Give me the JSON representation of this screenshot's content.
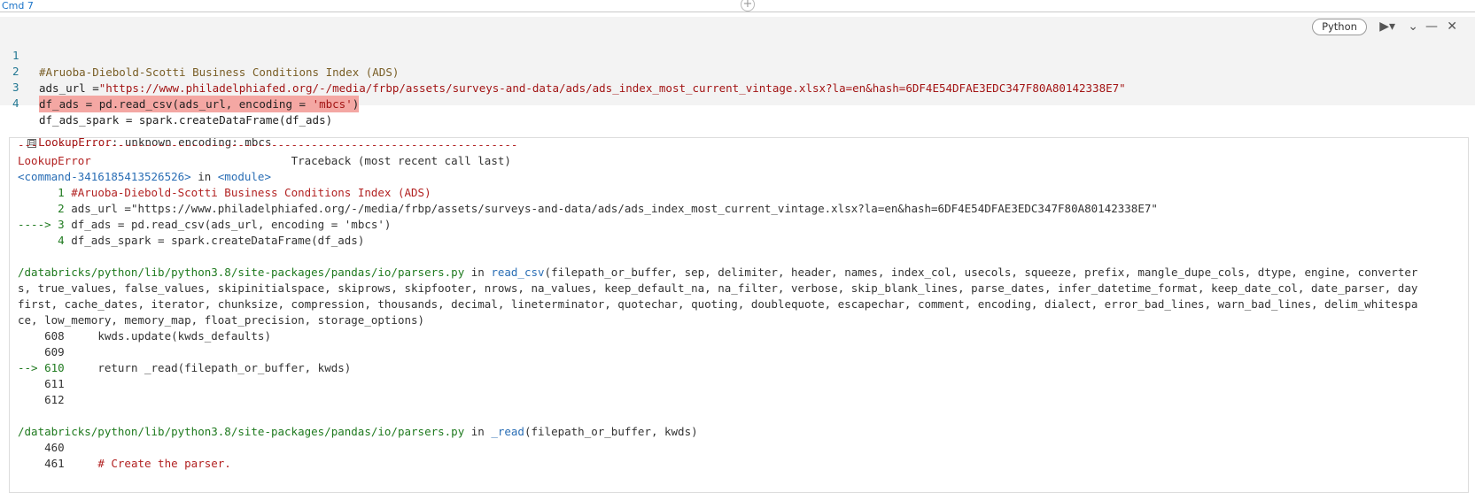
{
  "cmd": {
    "label": "Cmd 7",
    "add_icon": "+"
  },
  "toolbar": {
    "language": "Python",
    "run_icon": "▶▾",
    "collapse_icon": "⌄",
    "minimize_icon": "—",
    "close_icon": "✕"
  },
  "code_lines": [
    {
      "num": "1",
      "text": "#Aruoba-Diebold-Scotti Business Conditions Index (ADS)"
    },
    {
      "num": "2",
      "prefix": "ads_url =",
      "string": "\"https://www.philadelphiafed.org/-/media/frbp/assets/surveys-and-data/ads/ads_index_most_current_vintage.xlsx?la=en&hash=6DF4E54DFAE3EDC347F80A80142338E7\""
    },
    {
      "num": "3",
      "prefix": "df_ads = pd.read_csv(ads_url, encoding = ",
      "string": "'mbcs'",
      "suffix": ")"
    },
    {
      "num": "4",
      "text": "df_ads_spark = spark.createDataFrame(df_ads)"
    }
  ],
  "error": {
    "collapse_icon": "⊟",
    "name": "LookupError",
    "message": ": unknown encoding: mbcs"
  },
  "traceback": {
    "dashes": "---------------------------------------------------------------------------",
    "header_name": "LookupError",
    "header_right": "                              Traceback (most recent call last)",
    "command": "<command-3416185413526526>",
    "in_word": " in ",
    "module": "<module>",
    "frame1": [
      {
        "marker": "      1 ",
        "text": "#Aruoba-Diebold-Scotti Business Conditions Index (ADS)"
      },
      {
        "marker": "      2 ",
        "text": "ads_url =\"https://www.philadelphiafed.org/-/media/frbp/assets/surveys-and-data/ads/ads_index_most_current_vintage.xlsx?la=en&hash=6DF4E54DFAE3EDC347F80A80142338E7\""
      },
      {
        "marker": "----> 3 ",
        "text": "df_ads = pd.read_csv(ads_url, encoding = 'mbcs')"
      },
      {
        "marker": "      4 ",
        "text": "df_ads_spark = spark.createDataFrame(df_ads)"
      }
    ],
    "file_path": "/databricks/python/lib/python3.8/site-packages/pandas/io/parsers.py",
    "func1": "read_csv",
    "sig1_lines": [
      "(filepath_or_buffer, sep, delimiter, header, names, index_col, usecols, squeeze, prefix, mangle_dupe_cols, dtype, engine, converter",
      "s, true_values, false_values, skipinitialspace, skiprows, skipfooter, nrows, na_values, keep_default_na, na_filter, verbose, skip_blank_lines, parse_dates, infer_datetime_format, keep_date_col, date_parser, day",
      "first, cache_dates, iterator, chunksize, compression, thousands, decimal, lineterminator, quotechar, quoting, doublequote, escapechar, comment, encoding, dialect, error_bad_lines, warn_bad_lines, delim_whitespa",
      "ce, low_memory, memory_map, float_precision, storage_options)"
    ],
    "frame2": [
      {
        "marker": "    608 ",
        "text": "    kwds.update(kwds_defaults)"
      },
      {
        "marker": "    609 ",
        "text": ""
      },
      {
        "marker": "--> 610 ",
        "text": "    return _read(filepath_or_buffer, kwds)"
      },
      {
        "marker": "    611 ",
        "text": ""
      },
      {
        "marker": "    612 ",
        "text": ""
      }
    ],
    "func2": "_read",
    "sig2": "(filepath_or_buffer, kwds)",
    "frame3": [
      {
        "marker": "    460 ",
        "text": ""
      },
      {
        "marker": "    461 ",
        "text": "    # Create the parser."
      }
    ]
  },
  "colors": {
    "error_red": "#b22222",
    "marker_green": "#1f7a1f",
    "link_blue": "#2a6eb5",
    "highlight": "#f4a7a3",
    "cell_bg": "#f3f3f3"
  }
}
